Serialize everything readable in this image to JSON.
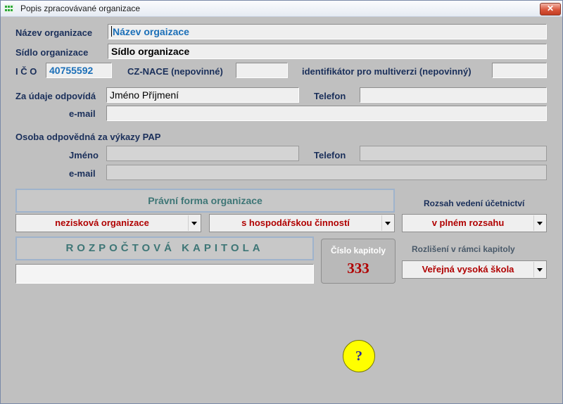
{
  "window": {
    "title": "Popis zpracovávané organizace",
    "close_label": "✕"
  },
  "form": {
    "nazev_label": "Název organizace",
    "nazev_value": "Název orgaizace",
    "sidlo_label": "Sídlo organizace",
    "sidlo_value": "Sídlo organizace",
    "ico_label": "I Č O",
    "ico_value": "40755592",
    "cznace_label": "CZ-NACE (nepovinné)",
    "cznace_value": "",
    "identifikator_label": "identifikátor pro multiverzi (nepovinný)",
    "identifikator_value": "",
    "zaudaje_label": "Za údaje odpovídá",
    "zaudaje_value": "Jméno Příjmení",
    "telefon_label": "Telefon",
    "telefon_value": "",
    "email_label": "e-mail",
    "email_value": ""
  },
  "pap": {
    "section_label": "Osoba odpovědná za výkazy PAP",
    "jmeno_label": "Jméno",
    "jmeno_value": "",
    "telefon_label": "Telefon",
    "telefon_value": "",
    "email_label": "e-mail",
    "email_value": ""
  },
  "pravni_forma": {
    "title": "Právní forma organizace",
    "select1": "nezisková organizace",
    "select2": "s hospodářskou činností"
  },
  "ucetnictvi": {
    "label": "Rozsah vedení účetnictví",
    "value": "v plném rozsahu"
  },
  "rozpoctova": {
    "title": "ROZPOČTOVÁ KAPITOLA",
    "value": "",
    "cislo_label": "Číslo kapitoly",
    "cislo_value": "333"
  },
  "rozliseni": {
    "label": "Rozlišení v rámci kapitoly",
    "value": "Veřejná vysoká škola"
  },
  "help": {
    "label": "?"
  },
  "colors": {
    "window_bg": "#c0c0c0",
    "label_text": "#1a2f5a",
    "blue_value": "#1b6fb8",
    "red_value": "#b00000",
    "help_button": "#ffff00"
  }
}
